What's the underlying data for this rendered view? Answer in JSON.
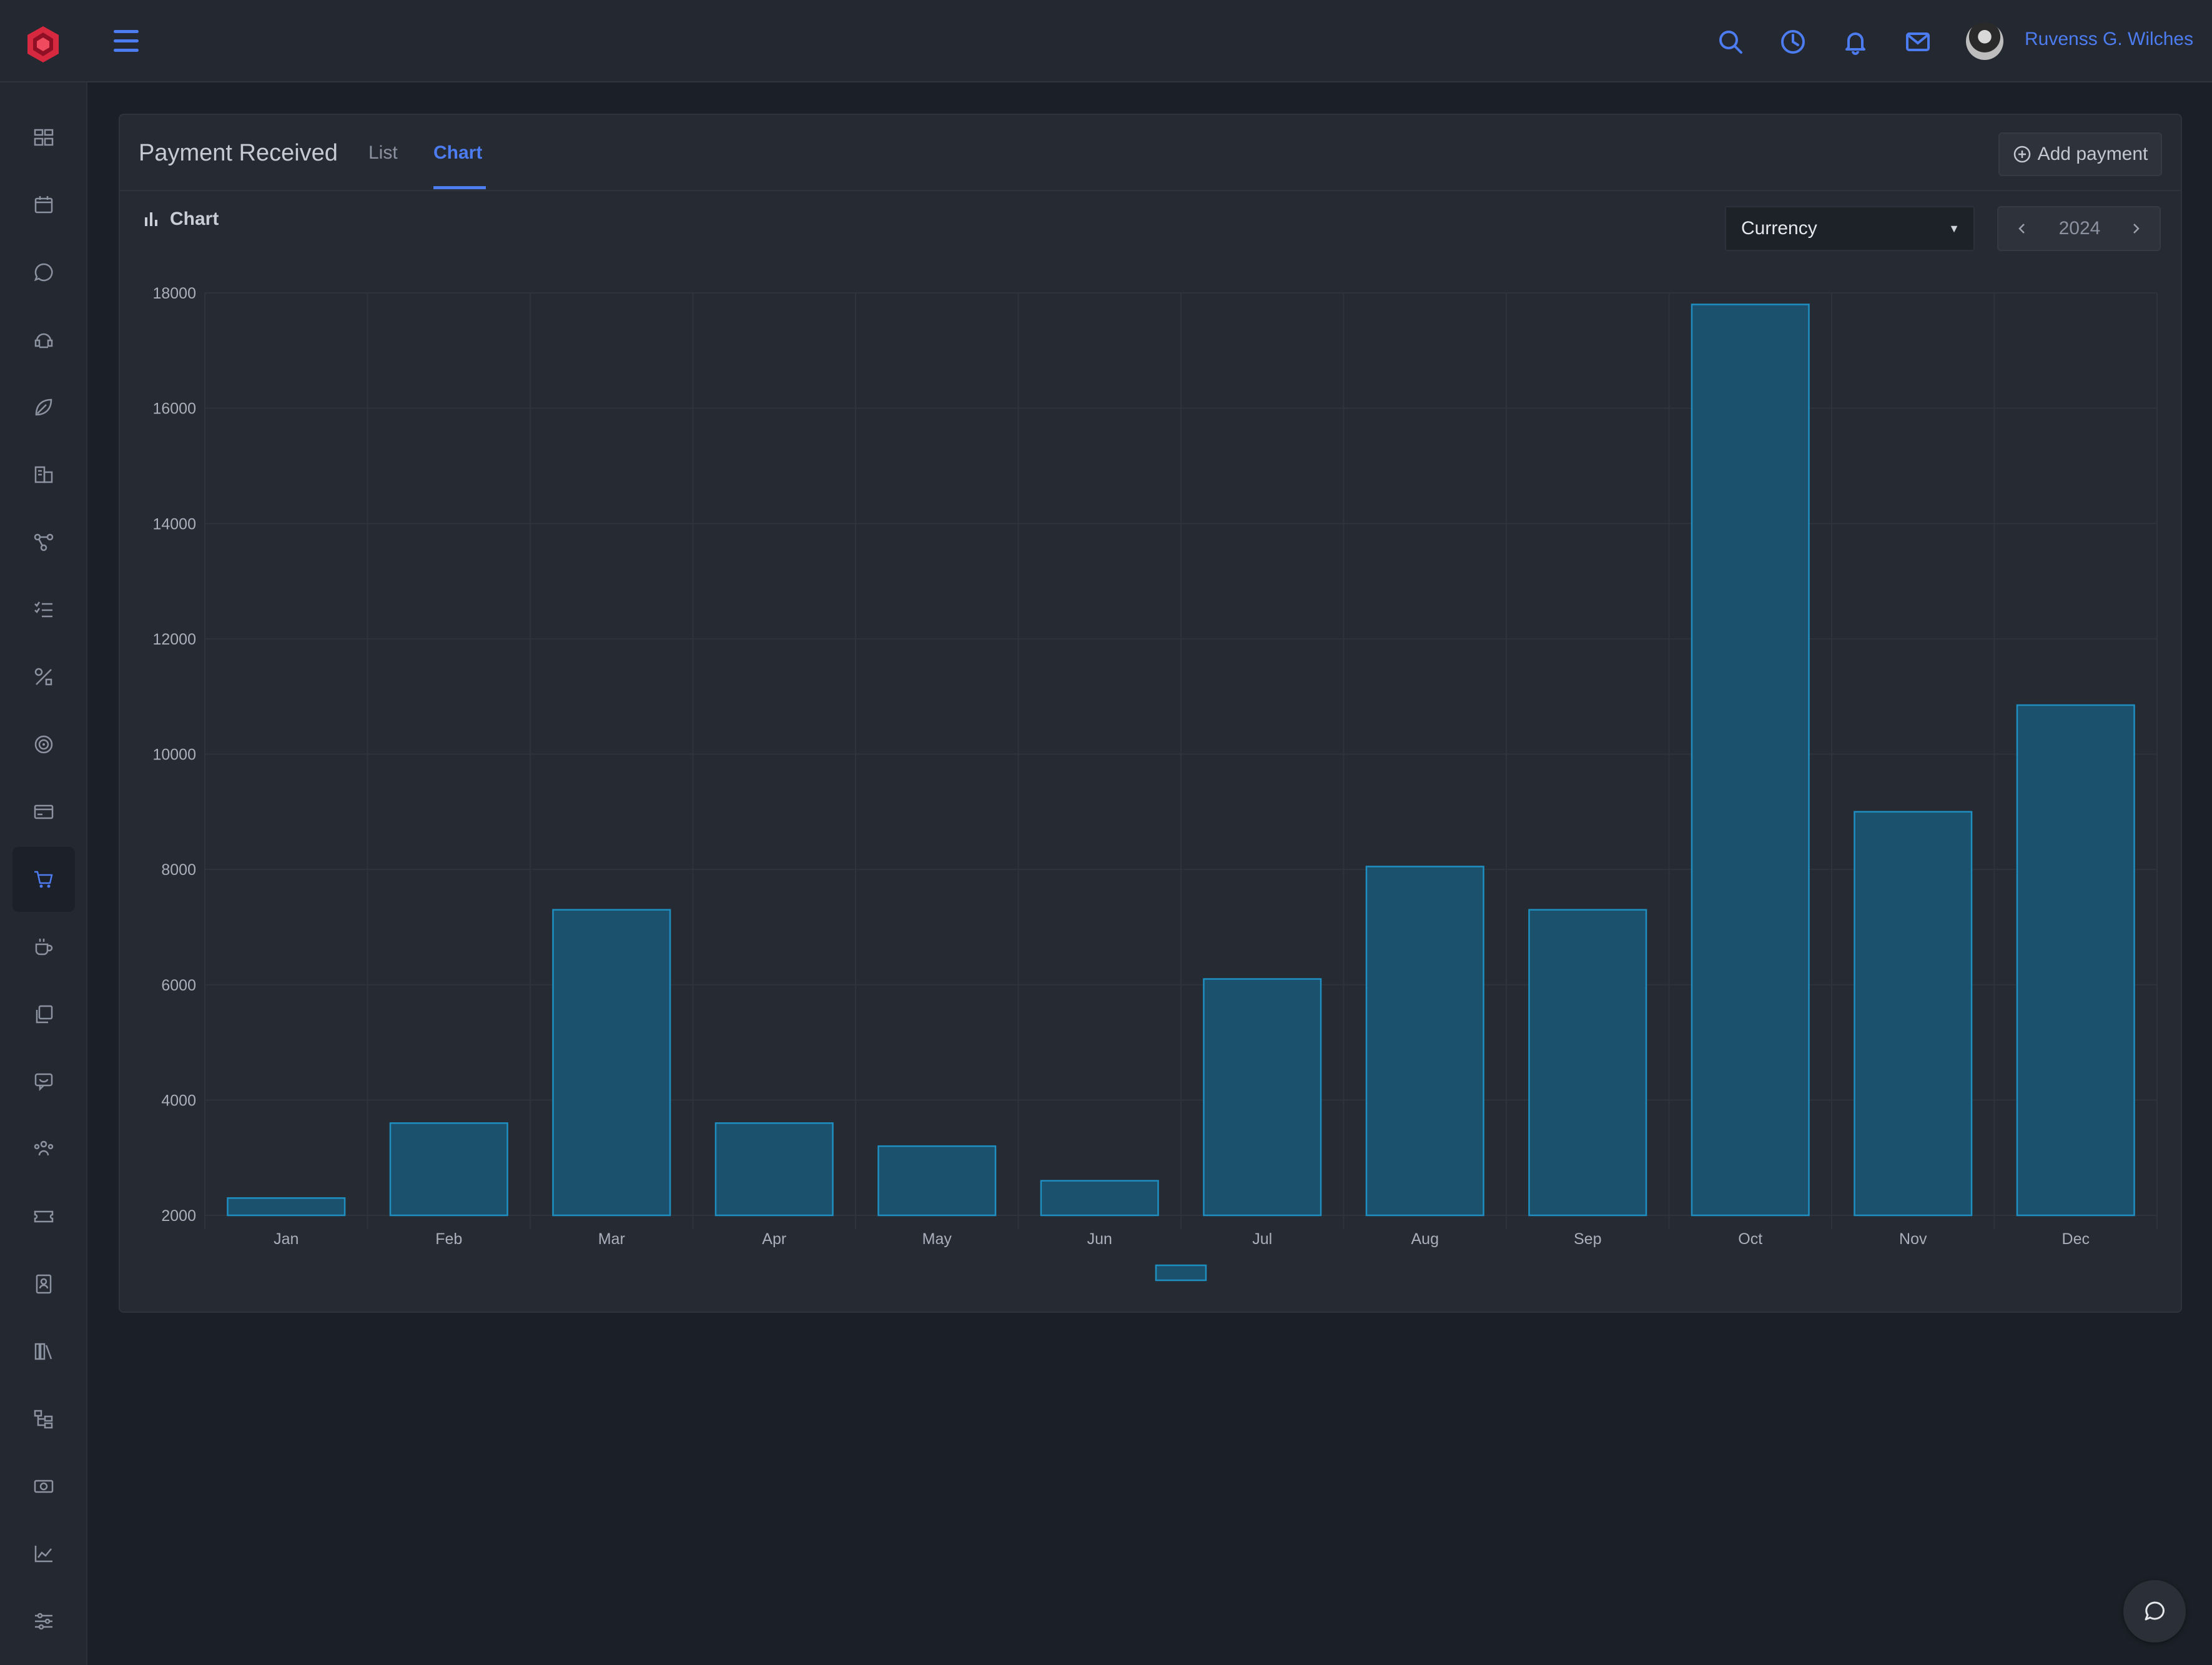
{
  "header": {
    "user_name": "Ruvenss G. Wilches",
    "icons": [
      "search-icon",
      "clock-icon",
      "bell-icon",
      "mail-icon"
    ]
  },
  "sidebar": {
    "items": [
      {
        "icon": "dashboard-icon"
      },
      {
        "icon": "calendar-icon"
      },
      {
        "icon": "whatsapp-icon"
      },
      {
        "icon": "support-icon"
      },
      {
        "icon": "leaf-icon"
      },
      {
        "icon": "buildings-icon"
      },
      {
        "icon": "network-icon"
      },
      {
        "icon": "checklist-icon"
      },
      {
        "icon": "tools-icon"
      },
      {
        "icon": "target-icon"
      },
      {
        "icon": "credit-card-icon"
      },
      {
        "icon": "cart-icon",
        "active": true
      },
      {
        "icon": "coffee-icon"
      },
      {
        "icon": "copy-icon"
      },
      {
        "icon": "chat-support-icon"
      },
      {
        "icon": "team-icon"
      },
      {
        "icon": "ticket-icon"
      },
      {
        "icon": "contact-book-icon"
      },
      {
        "icon": "library-icon"
      },
      {
        "icon": "hierarchy-icon"
      },
      {
        "icon": "money-icon"
      },
      {
        "icon": "line-chart-icon"
      },
      {
        "icon": "settings-sliders-icon"
      }
    ]
  },
  "page": {
    "title": "Payment Received",
    "tabs": [
      {
        "label": "List",
        "active": false
      },
      {
        "label": "Chart",
        "active": true
      }
    ],
    "add_button_label": "Add payment",
    "chart_section_label": "Chart",
    "currency_select_value": "Currency",
    "year": "2024"
  },
  "colors": {
    "accent": "#4c7cf0",
    "bar_fill": "#1b516d",
    "bar_stroke": "#1f8fc2",
    "brand": "#d6283f"
  },
  "chart_data": {
    "type": "bar",
    "categories": [
      "Jan",
      "Feb",
      "Mar",
      "Apr",
      "May",
      "Jun",
      "Jul",
      "Aug",
      "Sep",
      "Oct",
      "Nov",
      "Dec"
    ],
    "values": [
      2300,
      3600,
      7300,
      3600,
      3200,
      2600,
      6100,
      8050,
      7300,
      17800,
      9000,
      10850
    ],
    "ylim": [
      2000,
      18000
    ],
    "yticks": [
      2000,
      4000,
      6000,
      8000,
      10000,
      12000,
      14000,
      16000,
      18000
    ],
    "grid": true,
    "legend": "bottom-center",
    "title": "",
    "xlabel": "",
    "ylabel": ""
  }
}
